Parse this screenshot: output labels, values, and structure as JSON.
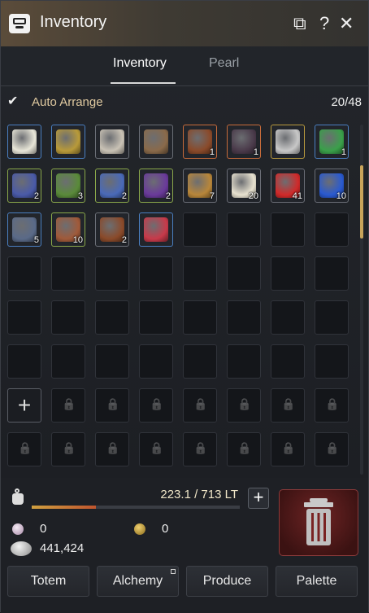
{
  "window": {
    "title": "Inventory"
  },
  "tabs": [
    {
      "label": "Inventory",
      "active": true
    },
    {
      "label": "Pearl",
      "active": false
    }
  ],
  "auto_arrange": {
    "label": "Auto Arrange",
    "checked": true
  },
  "slots": {
    "used": 20,
    "total": 48,
    "label": "20/48"
  },
  "items": [
    {
      "name": "wreath",
      "qty": "",
      "border": "blue",
      "color": "#e8e6d8"
    },
    {
      "name": "horn",
      "qty": "",
      "border": "blue",
      "color": "#b89a3a"
    },
    {
      "name": "cleaver",
      "qty": "",
      "border": "item",
      "color": "#c9c2b5"
    },
    {
      "name": "staff",
      "qty": "",
      "border": "item",
      "color": "#8a6a4a"
    },
    {
      "name": "book-red",
      "qty": "1",
      "border": "orange",
      "color": "#8a4a2a"
    },
    {
      "name": "book-dark",
      "qty": "1",
      "border": "orange",
      "color": "#4a3a4a"
    },
    {
      "name": "silver-tree",
      "qty": "",
      "border": "yellow",
      "color": "#c8c8c8"
    },
    {
      "name": "clover",
      "qty": "1",
      "border": "blue",
      "color": "#3aa04a"
    },
    {
      "name": "potion-blue",
      "qty": "2",
      "border": "green",
      "color": "#4a5aa8"
    },
    {
      "name": "potion-green",
      "qty": "3",
      "border": "green",
      "color": "#5a8a3a"
    },
    {
      "name": "potion-blue",
      "qty": "2",
      "border": "green",
      "color": "#4a6ab8"
    },
    {
      "name": "potion-purple",
      "qty": "2",
      "border": "green",
      "color": "#6a3a9a"
    },
    {
      "name": "soup",
      "qty": "7",
      "border": "item",
      "color": "#b8863a"
    },
    {
      "name": "milk",
      "qty": "20",
      "border": "item",
      "color": "#e8e2d0"
    },
    {
      "name": "hp-potion",
      "qty": "41",
      "border": "item",
      "color": "#d02a2a"
    },
    {
      "name": "mp-potion",
      "qty": "10",
      "border": "item",
      "color": "#2a5ad0"
    },
    {
      "name": "chest",
      "qty": "5",
      "border": "blue",
      "color": "#5a6a88"
    },
    {
      "name": "bowl",
      "qty": "10",
      "border": "green",
      "color": "#a05a3a"
    },
    {
      "name": "log",
      "qty": "2",
      "border": "item",
      "color": "#8a4a2a"
    },
    {
      "name": "firecracker",
      "qty": "",
      "border": "blue",
      "color": "#c83a4a"
    }
  ],
  "weight": {
    "text": "223.1 / 713 LT",
    "fraction": 0.31
  },
  "currency": {
    "silver": "441,424",
    "pearls": "0",
    "coins": "0"
  },
  "buttons": [
    "Totem",
    "Alchemy",
    "Produce",
    "Palette"
  ],
  "colors": {
    "accent": "#c8a45a",
    "trash": "#6e2424",
    "auto_arrange_text": "#e0c9a0"
  }
}
